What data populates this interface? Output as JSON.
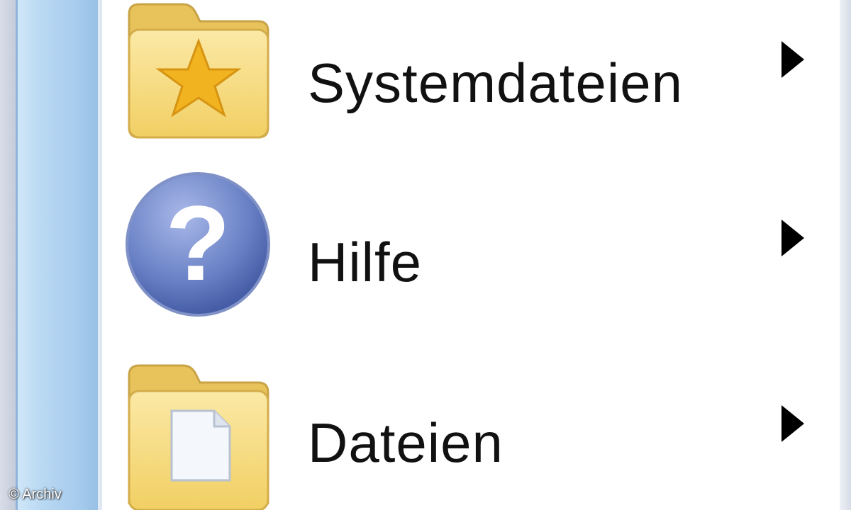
{
  "menu": {
    "items": [
      {
        "label": "Systemdateien",
        "icon": "folder-star-icon",
        "has_submenu": true
      },
      {
        "label": "Hilfe",
        "icon": "help-icon",
        "has_submenu": true
      },
      {
        "label": "Dateien",
        "icon": "folder-document-icon",
        "has_submenu": true
      }
    ]
  },
  "watermark": {
    "text": "© Archiv"
  },
  "colors": {
    "side_strip": "#b9d9f3",
    "folder": "#f6dc7e",
    "help_circle": "#5a72b8",
    "text": "#111111"
  }
}
